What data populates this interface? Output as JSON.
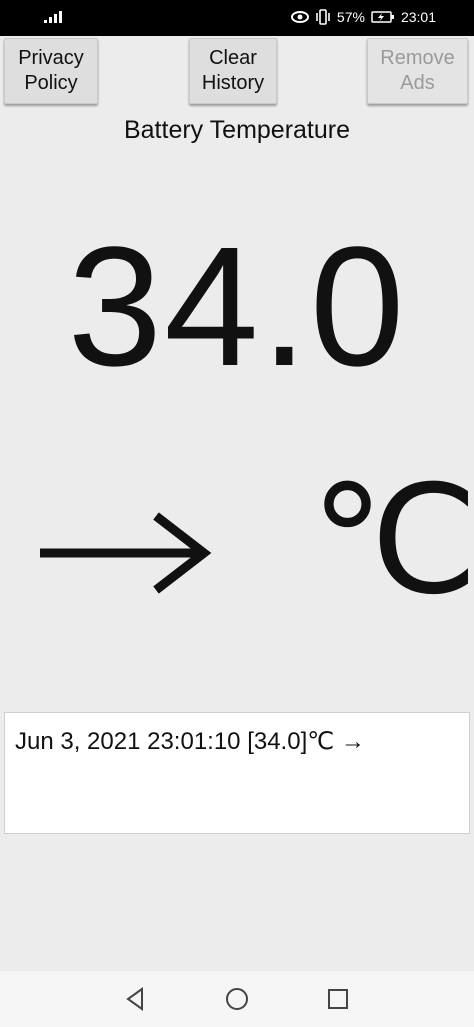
{
  "status_bar": {
    "battery_percent": "57%",
    "time": "23:01",
    "icons": [
      "signal-icon",
      "eye-icon",
      "vibrate-icon",
      "battery-charging-icon"
    ]
  },
  "toolbar": {
    "privacy_label": "Privacy\nPolicy",
    "clear_label": "Clear\nHistory",
    "remove_ads_label": "Remove\nAds",
    "remove_ads_enabled": false
  },
  "main": {
    "title": "Battery Temperature",
    "temperature": "34.0",
    "unit": "℃",
    "trend_icon": "arrow-right-icon"
  },
  "history": {
    "entries": [
      "Jun 3, 2021 23:01:10 [34.0]℃ →"
    ]
  },
  "navigation": {
    "icons": [
      "back-icon",
      "home-icon",
      "recents-icon"
    ]
  }
}
